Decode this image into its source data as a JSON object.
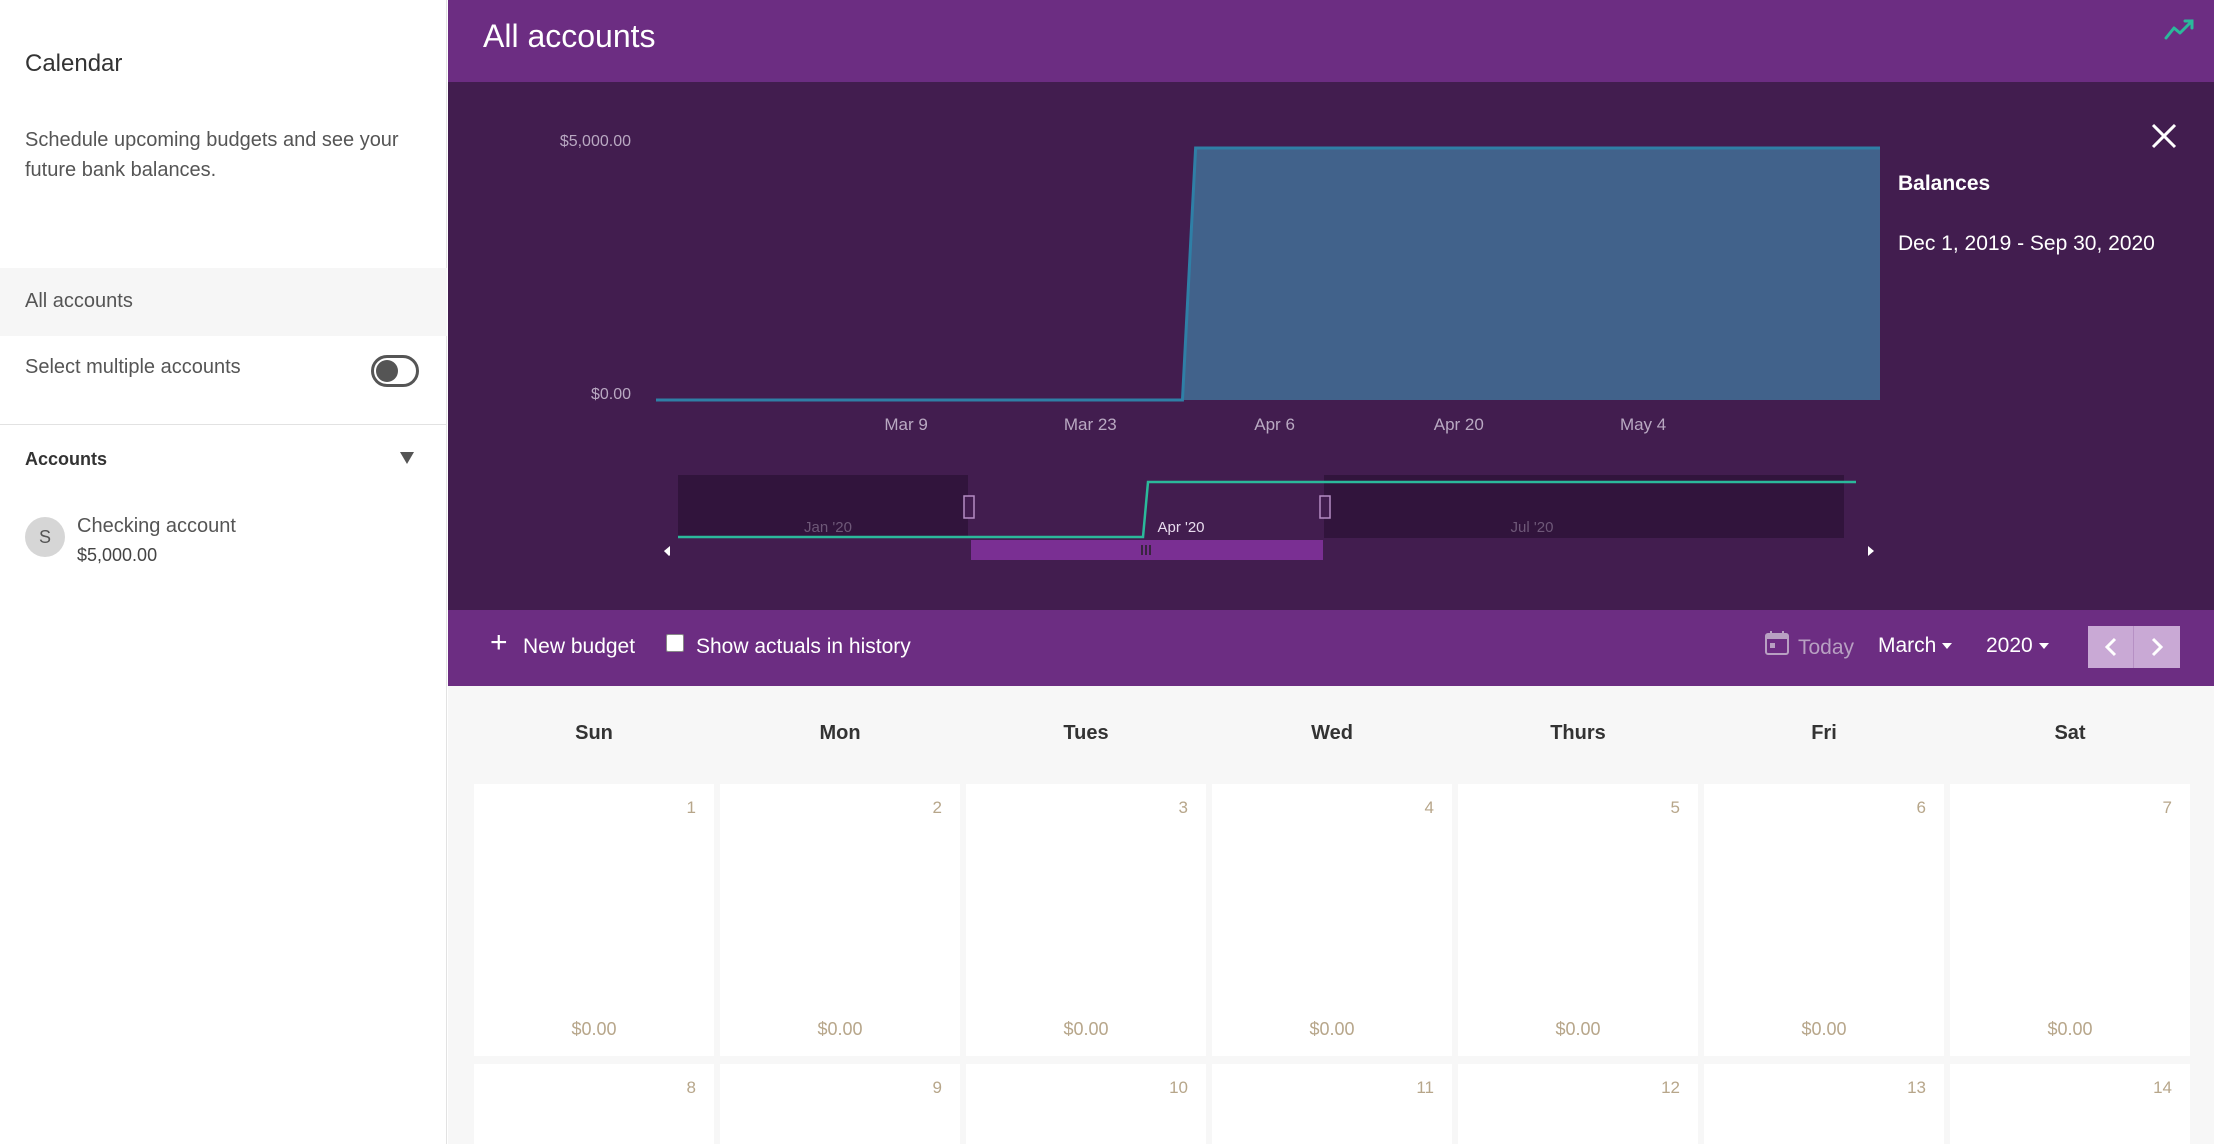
{
  "sidebar": {
    "title": "Calendar",
    "description": "Schedule upcoming budgets and see your future bank balances.",
    "all_accounts": "All accounts",
    "select_multiple": "Select multiple accounts",
    "accounts_heading": "Accounts",
    "accounts": [
      {
        "initial": "S",
        "name": "Checking account",
        "balance": "$5,000.00"
      }
    ]
  },
  "header": {
    "title": "All accounts",
    "icon": "trend-line-icon"
  },
  "balances": {
    "title": "Balances",
    "range": "Dec 1, 2019 - Sep 30, 2020"
  },
  "chart_data": {
    "type": "area",
    "title": "Balances",
    "y_tick_labels": [
      "$5,000.00",
      "$0.00"
    ],
    "ylim": [
      0,
      5000
    ],
    "x_tick_labels": [
      "Mar 9",
      "Mar 23",
      "Apr 6",
      "Apr 20",
      "May 4"
    ],
    "series": [
      {
        "points": [
          [
            "Feb 19",
            0
          ],
          [
            "Mar 30",
            0
          ],
          [
            "Mar 31",
            5000
          ],
          [
            "May 22",
            5000
          ]
        ],
        "color": "#41628b"
      }
    ],
    "navigator": {
      "labels": [
        "Jan '20",
        "Apr '20",
        "Jul '20"
      ],
      "line_color": "#2bb99b"
    },
    "grid": false,
    "legend": "none"
  },
  "toolbar": {
    "new_budget": "New budget",
    "show_actuals": "Show actuals in history",
    "today": "Today",
    "month": "March",
    "year": "2020"
  },
  "calendar": {
    "weekdays": [
      "Sun",
      "Mon",
      "Tues",
      "Wed",
      "Thurs",
      "Fri",
      "Sat"
    ],
    "week1": [
      {
        "day": "1",
        "amount": "$0.00"
      },
      {
        "day": "2",
        "amount": "$0.00"
      },
      {
        "day": "3",
        "amount": "$0.00"
      },
      {
        "day": "4",
        "amount": "$0.00"
      },
      {
        "day": "5",
        "amount": "$0.00"
      },
      {
        "day": "6",
        "amount": "$0.00"
      },
      {
        "day": "7",
        "amount": "$0.00"
      }
    ],
    "week2": [
      {
        "day": "8"
      },
      {
        "day": "9"
      },
      {
        "day": "10"
      },
      {
        "day": "11"
      },
      {
        "day": "12"
      },
      {
        "day": "13"
      },
      {
        "day": "14"
      }
    ]
  },
  "colors": {
    "brand_purple": "#6c2d82",
    "chart_bg": "#421d4f",
    "area_fill": "#41628b",
    "nav_line": "#2bb99b"
  }
}
